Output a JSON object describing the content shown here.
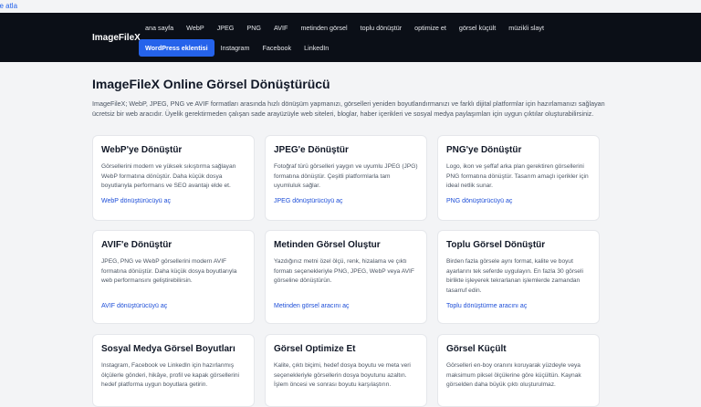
{
  "skip_link": "ge atla",
  "brand": "ImageFileX",
  "nav_row1": [
    "ana sayfa",
    "WebP",
    "JPEG",
    "PNG",
    "AVIF",
    "metinden görsel",
    "toplu dönüştür",
    "optimize et",
    "görsel küçült",
    "müzikli slayt"
  ],
  "nav_row2": [
    "WordPress eklentisi",
    "Instagram",
    "Facebook",
    "LinkedIn"
  ],
  "title": "ImageFileX Online Görsel Dönüştürücü",
  "intro": "ImageFileX; WebP, JPEG, PNG ve AVIF formatları arasında hızlı dönüşüm yapmanızı, görselleri yeniden boyutlandırmanızı ve farklı dijital platformlar için hazırlamanızı sağlayan ücretsiz bir web aracıdır. Üyelik gerektirmeden çalışan sade arayüzüyle web siteleri, bloglar, haber içerikleri ve sosyal medya paylaşımları için uygun çıktılar oluşturabilirsiniz.",
  "cards": [
    {
      "title": "WebP'ye Dönüştür",
      "desc": "Görsellerini modern ve yüksek sıkıştırma sağlayan WebP formatına dönüştür. Daha küçük dosya boyutlarıyla performans ve SEO avantajı elde et.",
      "link": "WebP dönüştürücüyü aç"
    },
    {
      "title": "JPEG'e Dönüştür",
      "desc": "Fotoğraf türü görselleri yaygın ve uyumlu JPEG (JPG) formatına dönüştür. Çeşitli platformlarla tam uyumluluk sağlar.",
      "link": "JPEG dönüştürücüyü aç"
    },
    {
      "title": "PNG'ye Dönüştür",
      "desc": "Logo, ikon ve şeffaf arka plan gerektiren görsellerini PNG formatına dönüştür. Tasarım amaçlı içerikler için ideal netlik sunar.",
      "link": "PNG dönüştürücüyü aç"
    },
    {
      "title": "AVIF'e Dönüştür",
      "desc": "JPEG, PNG ve WebP görsellerini modern AVIF formatına dönüştür. Daha küçük dosya boyutlarıyla web performansını geliştirebilirsin.",
      "link": "AVIF dönüştürücüyü aç"
    },
    {
      "title": "Metinden Görsel Oluştur",
      "desc": "Yazdığınız metni özel ölçü, renk, hizalama ve çıktı formatı seçenekleriyle PNG, JPEG, WebP veya AVIF görseline dönüştürün.",
      "link": "Metinden görsel aracını aç"
    },
    {
      "title": "Toplu Görsel Dönüştür",
      "desc": "Birden fazla görsele aynı format, kalite ve boyut ayarlarını tek seferde uygulayın. En fazla 30 görseli birlikte işleyerek tekrarlanan işlemlerde zamandan tasarruf edin.",
      "link": "Toplu dönüştürme aracını aç"
    },
    {
      "title": "Sosyal Medya Görsel Boyutları",
      "desc": "Instagram, Facebook ve LinkedIn için hazırlanmış ölçülerle gönderi, hikâye, profil ve kapak görsellerini hedef platforma uygun boyutlara getirin.",
      "link": ""
    },
    {
      "title": "Görsel Optimize Et",
      "desc": "Kalite, çıktı biçimi, hedef dosya boyutu ve meta veri seçenekleriyle görsellerin dosya boyutunu azaltın. İşlem öncesi ve sonrası boyutu karşılaştırın.",
      "link": ""
    },
    {
      "title": "Görsel Küçült",
      "desc": "Görselleri en-boy oranını koruyarak yüzdeyle veya maksimum piksel ölçülerine göre küçültün. Kaynak görselden daha büyük çıktı oluşturulmaz.",
      "link": ""
    }
  ]
}
